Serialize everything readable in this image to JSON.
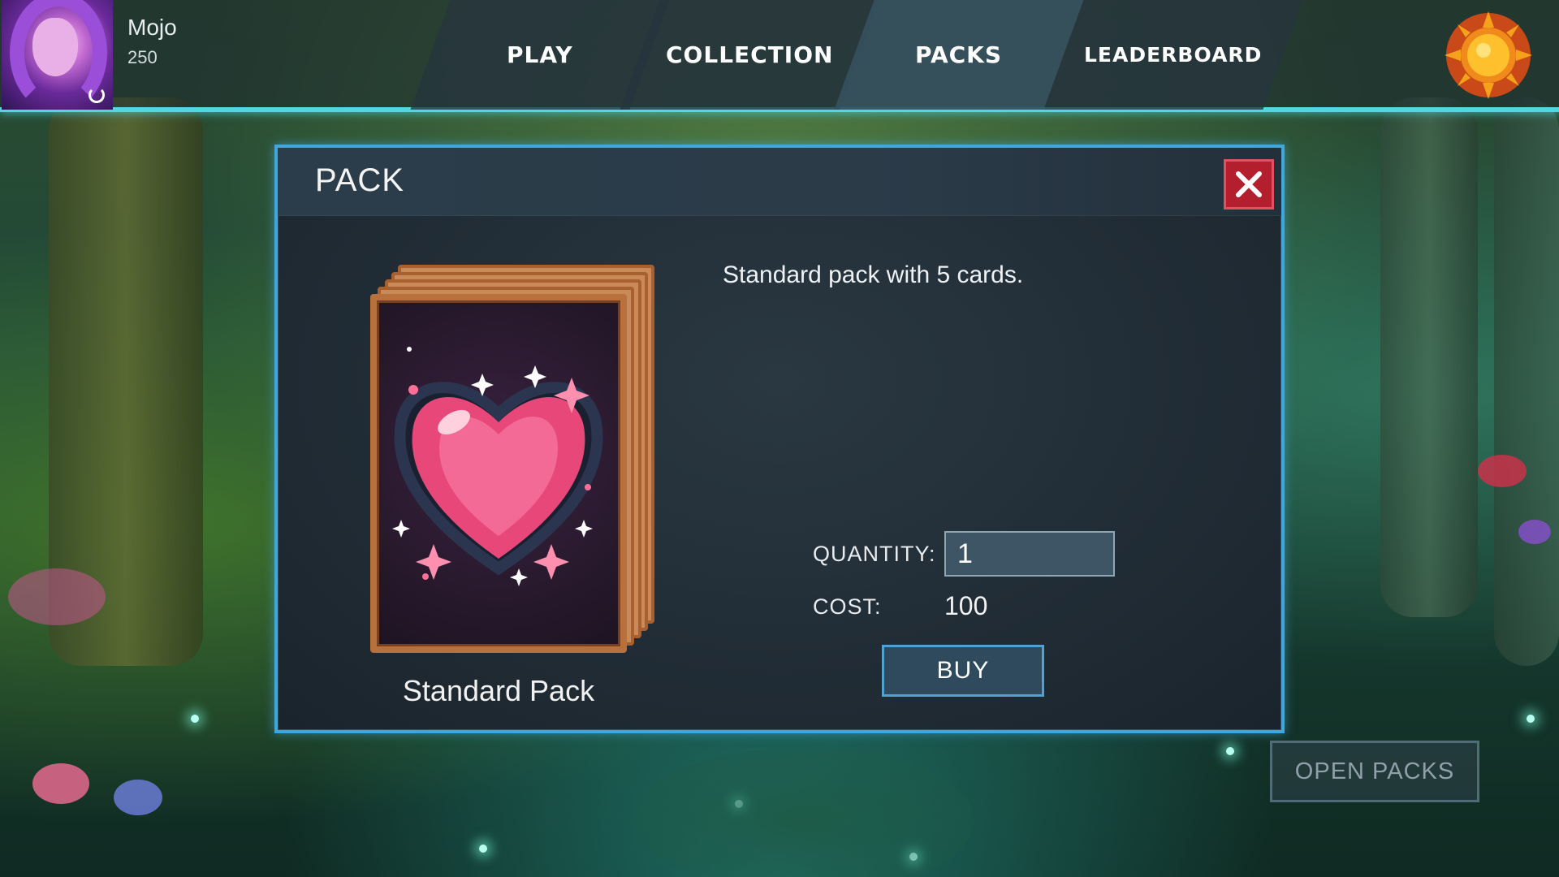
{
  "user": {
    "name": "Mojo",
    "coins": "250"
  },
  "nav": {
    "tabs": [
      {
        "label": "PLAY"
      },
      {
        "label": "COLLECTION"
      },
      {
        "label": "PACKS",
        "active": true
      },
      {
        "label": "LEADERBOARD"
      }
    ]
  },
  "modal": {
    "title": "PACK",
    "pack_name": "Standard Pack",
    "description": "Standard pack with 5 cards.",
    "quantity_label": "QUANTITY:",
    "quantity_value": "1",
    "cost_label": "COST:",
    "cost_value": "100",
    "buy_label": "BUY"
  },
  "footer": {
    "open_packs_label": "OPEN PACKS"
  },
  "icons": {
    "close": "close-icon",
    "settings": "sun-emblem-icon",
    "pack_art": "heart-gem-icon"
  },
  "colors": {
    "accent_cyan": "#52d6df",
    "modal_border": "#41a6dc",
    "close_red": "#b41f2e",
    "card_frame": "#b8703c",
    "heart_pink": "#e8477a"
  }
}
